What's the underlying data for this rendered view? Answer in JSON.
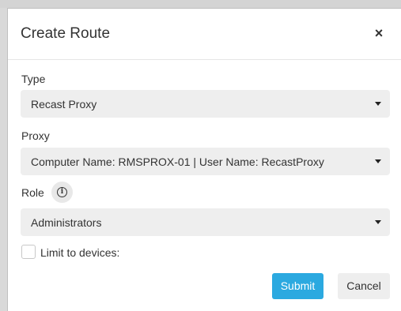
{
  "modal": {
    "title": "Create Route",
    "close_glyph": "×"
  },
  "form": {
    "type": {
      "label": "Type",
      "value": "Recast Proxy"
    },
    "proxy": {
      "label": "Proxy",
      "value": "Computer Name: RMSPROX-01 | User Name: RecastProxy"
    },
    "role": {
      "label": "Role",
      "info_icon": "info-circle-icon",
      "info_glyph": "i",
      "value": "Administrators"
    },
    "limit_to_devices": {
      "label": "Limit to devices:",
      "checked": false
    }
  },
  "actions": {
    "submit_label": "Submit",
    "cancel_label": "Cancel"
  },
  "colors": {
    "primary": "#2ba9e0",
    "select_bg": "#eeeeee",
    "backdrop": "#d9d9d9"
  }
}
